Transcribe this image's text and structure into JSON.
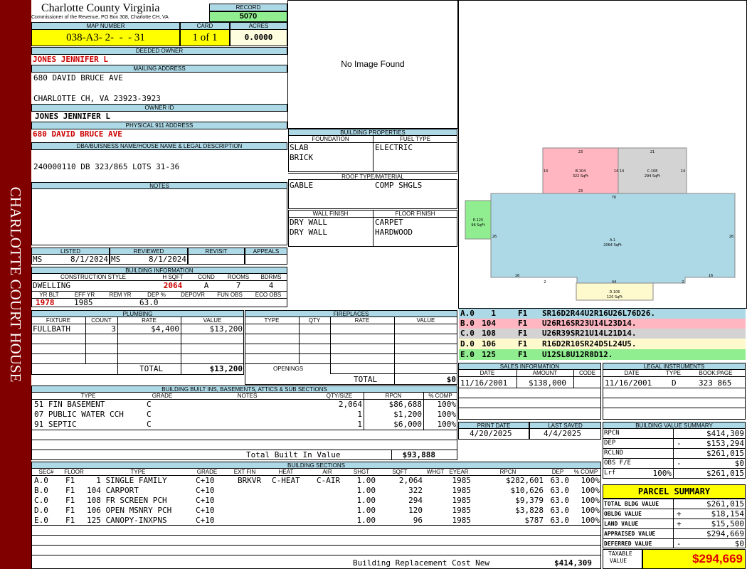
{
  "sidebar_title": "CHARLOTTE COURT HOUSE",
  "header": {
    "county": "Charlotte County Virginia",
    "commissioner": "Commissioner of the Revenue, PO Box 308, Charlotte CH, VA",
    "record_label": "RECORD",
    "record": "5070",
    "map_label": "MAP NUMBER",
    "map_number": "038-A3- 2-  -  - 31",
    "card_label": "CARD",
    "card": "1 of 1",
    "acres_label": "ACRES",
    "acres": "0.0000"
  },
  "owner": {
    "deeded_label": "DEEDED OWNER",
    "deeded": "JONES JENNIFER L",
    "mailing_label": "MAILING ADDRESS",
    "mail1": "680 DAVID BRUCE AVE",
    "mail2": "CHARLOTTE CH, VA 23923-3923",
    "owner_id_label": "OWNER ID",
    "owner_id": "JONES JENNIFER L",
    "phys_label": "PHYSICAL 911 ADDRESS",
    "phys": "680 DAVID BRUCE AVE",
    "legal_label": "DBA/BUISNESS NAME/HOUSE NAME & LEGAL DESCRIPTION",
    "legal": "240000110 DB 323/865 LOTS 31-36",
    "notes_label": "NOTES"
  },
  "image_text": "No Image Found",
  "listed": {
    "listed_label": "LISTED",
    "listed_by": "MS",
    "listed_date": "8/1/2024",
    "reviewed_label": "REVIEWED",
    "reviewed_by": "MS",
    "reviewed_date": "8/1/2024",
    "revisit_label": "REVISIT",
    "appeals_label": "APPEALS"
  },
  "building_info": {
    "label": "BUILDING INFORMATION",
    "h_style": "CONSTRUCTION STYLE",
    "h_hsqft": "H SQFT",
    "h_cond": "COND",
    "h_rooms": "ROOMS",
    "h_bdrms": "BDRMS",
    "style": "DWELLING",
    "hsqft": "2064",
    "cond": "A",
    "rooms": "7",
    "bdrms": "4",
    "h_yrblt": "YR BLT",
    "h_effyr": "EFF YR",
    "h_remyr": "REM YR",
    "h_dep": "DEP %",
    "h_depovr": "DEPOVR",
    "h_funobs": "FUN OBS",
    "h_ecoobs": "ECO OBS",
    "yrblt": "1978",
    "effyr": "1985",
    "remyr": "",
    "dep": "63.0",
    "depovr": "",
    "funobs": "",
    "ecoobs": ""
  },
  "properties": {
    "label": "BUILDING PROPERTIES",
    "foundation_label": "FOUNDATION",
    "fuel_label": "FUEL TYPE",
    "foundation1": "SLAB",
    "foundation2": "BRICK",
    "fuel": "ELECTRIC",
    "roof_label": "ROOF TYPE/MATERIAL",
    "roof_type": "GABLE",
    "roof_material": "COMP SHGLS",
    "wall_label": "WALL FINISH",
    "floor_label": "FLOOR FINISH",
    "wall1": "DRY WALL",
    "wall2": "DRY WALL",
    "floor1": "CARPET",
    "floor2": "HARDWOOD"
  },
  "sketch": {
    "areas": [
      {
        "name": "B.104",
        "sqft": "322 SqFt",
        "top": "23",
        "bottom": "23",
        "left": "14",
        "right": "14",
        "color": "#ffb6c1"
      },
      {
        "name": "C.108",
        "sqft": "294 SqFt",
        "top": "21",
        "left": "14",
        "right": "14",
        "color": "#d3d3d3"
      },
      {
        "name": "E.125",
        "sqft": "96 SqFt",
        "color": "#90ee90"
      },
      {
        "name": "A.1",
        "sqft": "2064 SqFt",
        "top": "76",
        "left": "26",
        "right": "26",
        "b1": "16",
        "b2": "2",
        "b3": "44",
        "b4": "2",
        "b5": "16",
        "color": "#add8e6"
      },
      {
        "name": "D.106",
        "sqft": "120 SqFt",
        "color": "#fffacd"
      }
    ],
    "codes": [
      {
        "sec": "A.0",
        "num": "1",
        "floor": "F1",
        "code": "SR16D2R44U2R16U26L76D26.",
        "color": "#add8e6"
      },
      {
        "sec": "B.0",
        "num": "104",
        "floor": "F1",
        "code": "U26R16SR23U14L23D14.",
        "color": "#ffb6c1"
      },
      {
        "sec": "C.0",
        "num": "108",
        "floor": "F1",
        "code": "U26R39SR21U14L21D14.",
        "color": "#d3d3d3"
      },
      {
        "sec": "D.0",
        "num": "106",
        "floor": "F1",
        "code": "R16D2R10SR24D5L24U5.",
        "color": "#fffacd"
      },
      {
        "sec": "E.0",
        "num": "125",
        "floor": "F1",
        "code": "U12SL8U12R8D12.",
        "color": "#90ee90"
      }
    ]
  },
  "plumbing": {
    "label": "PLUMBING",
    "h_fixture": "FIXTURE",
    "h_count": "COUNT",
    "h_rate": "RATE",
    "h_value": "VALUE",
    "fixture": "FULLBATH",
    "count": "3",
    "rate": "$4,400",
    "value": "$13,200",
    "total_label": "TOTAL",
    "total": "$13,200"
  },
  "fireplaces": {
    "label": "FIREPLACES",
    "h_type": "TYPE",
    "h_qty": "QTY",
    "h_rate": "RATE",
    "h_value": "VALUE",
    "openings_label": "OPENINGS",
    "total_label": "TOTAL",
    "total": "$0"
  },
  "sales": {
    "label": "SALES INFORMATION",
    "h_date": "DATE",
    "h_amount": "AMOUNT",
    "h_code": "CODE",
    "date": "11/16/2001",
    "amount": "$138,000",
    "code": ""
  },
  "legal_instr": {
    "label": "LEGAL INSTRUMENTS",
    "h_date": "DATE",
    "h_type": "TYPE",
    "h_book": "BOOK:PAGE",
    "date": "11/16/2001",
    "type": "D",
    "book": "323 865"
  },
  "builtins": {
    "label": "BUILDING BUILT INS, BASEMENTS, ATTICS & SUB SECTIONS",
    "h_type": "TYPE",
    "h_grade": "GRADE",
    "h_notes": "NOTES",
    "h_qty": "QTY/SIZE",
    "h_rpcn": "RPCN",
    "h_comp": "% COMP",
    "rows": [
      {
        "type": "51 FIN BASEMENT",
        "grade": "C",
        "qty": "2,064",
        "rpcn": "$86,688",
        "comp": "100%"
      },
      {
        "type": "07 PUBLIC WATER CCH",
        "grade": "C",
        "qty": "1",
        "rpcn": "$1,200",
        "comp": "100%"
      },
      {
        "type": "91 SEPTIC",
        "grade": "C",
        "qty": "1",
        "rpcn": "$6,000",
        "comp": "100%"
      }
    ],
    "total_label": "Total Built In Value",
    "total": "$93,888"
  },
  "print": {
    "print_label": "PRINT DATE",
    "print_date": "4/20/2025",
    "saved_label": "LAST SAVED",
    "saved_date": "4/4/2025"
  },
  "value_summary": {
    "label": "BUILDING VALUE SUMMARY",
    "rows": [
      {
        "label": "RPCN",
        "sign": "",
        "value": "$414,309"
      },
      {
        "label": "DEP",
        "sign": "-",
        "value": "$153,294"
      },
      {
        "label": "RCLND",
        "sign": "",
        "value": "$261,015"
      },
      {
        "label": "OBS F/E",
        "sign": "-",
        "value": "$0"
      },
      {
        "label": "Lrf",
        "pct": "100%",
        "sign": "",
        "value": "$261,015"
      }
    ]
  },
  "parcel_summary": {
    "label": "PARCEL SUMMARY",
    "rows": [
      {
        "label": "TOTAL BLDG VALUE",
        "sign": "",
        "value": "$261,015"
      },
      {
        "label": "OBLDG VALUE",
        "sign": "+",
        "value": "$18,154"
      },
      {
        "label": "LAND VALUE",
        "sign": "+",
        "value": "$15,500"
      },
      {
        "label": "APPRAISED VALUE",
        "sign": "",
        "value": "$294,669"
      },
      {
        "label": "DEFERRED VALUE",
        "sign": "-",
        "value": "$0"
      }
    ],
    "taxable_label1": "TAXABLE",
    "taxable_label2": "VALUE",
    "taxable": "$294,669"
  },
  "sections": {
    "label": "BUILDING SECTIONS",
    "h_sec": "SEC#",
    "h_floor": "FLOOR",
    "h_type": "TYPE",
    "h_grade": "GRADE",
    "h_extfin": "EXT FIN",
    "h_heat": "HEAT",
    "h_air": "AIR",
    "h_shgt": "SHGT",
    "h_sqft": "SQFT",
    "h_whgt": "WHGT",
    "h_eyear": "EYEAR",
    "h_rpcn": "RPCN",
    "h_dep": "DEP",
    "h_comp": "% COMP",
    "rows": [
      {
        "sec": "A.0",
        "floor": "F1",
        "type": "  1 SINGLE FAMILY",
        "grade": "C+10",
        "extfin": "BRKVR",
        "heat": "C-HEAT",
        "air": "C-AIR",
        "shgt": "1.00",
        "sqft": "2,064",
        "eyear": "1985",
        "rpcn": "$282,601",
        "dep": "63.0",
        "comp": "100%"
      },
      {
        "sec": "B.0",
        "floor": "F1",
        "type": "104 CARPORT",
        "grade": "C+10",
        "extfin": "",
        "heat": "",
        "air": "",
        "shgt": "1.00",
        "sqft": "322",
        "eyear": "1985",
        "rpcn": "$10,626",
        "dep": "63.0",
        "comp": "100%"
      },
      {
        "sec": "C.0",
        "floor": "F1",
        "type": "108 FR SCREEN PCH",
        "grade": "C+10",
        "extfin": "",
        "heat": "",
        "air": "",
        "shgt": "1.00",
        "sqft": "294",
        "eyear": "1985",
        "rpcn": "$9,379",
        "dep": "63.0",
        "comp": "100%"
      },
      {
        "sec": "D.0",
        "floor": "F1",
        "type": "106 OPEN MSNRY PCH",
        "grade": "C+10",
        "extfin": "",
        "heat": "",
        "air": "",
        "shgt": "1.00",
        "sqft": "120",
        "eyear": "1985",
        "rpcn": "$3,828",
        "dep": "63.0",
        "comp": "100%"
      },
      {
        "sec": "E.0",
        "floor": "F1",
        "type": "125 CANOPY-INXPNS",
        "grade": "C+10",
        "extfin": "",
        "heat": "",
        "air": "",
        "shgt": "1.00",
        "sqft": "96",
        "eyear": "1985",
        "rpcn": "$787",
        "dep": "63.0",
        "comp": "100%"
      }
    ],
    "total_label": "Building Replacement Cost New",
    "total": "$414,309"
  }
}
